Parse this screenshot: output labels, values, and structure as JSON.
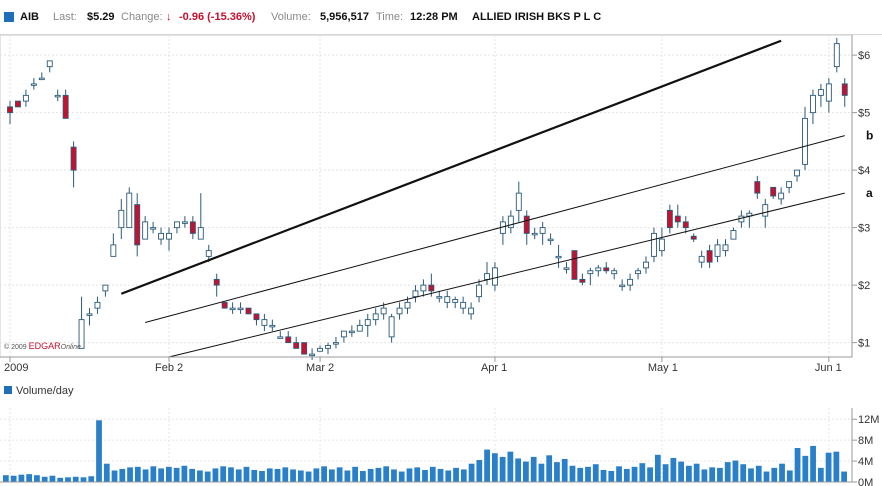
{
  "header": {
    "symbol": "AIB",
    "last_label": "Last:",
    "last_value": "$5.29",
    "change_label": "Change:",
    "change_value": "-0.96 (-15.36%)",
    "volume_label": "Volume:",
    "volume_value": "5,956,517",
    "time_label": "Time:",
    "time_value": "12:28 PM",
    "company": "ALLIED IRISH BKS P L C",
    "accent_color": "#1f6fb8",
    "down_color": "#c8102e",
    "arrow_icon": "down-arrow-icon"
  },
  "chart_data": {
    "type": "candlestick",
    "price_axis": {
      "ticks": [
        1,
        2,
        3,
        4,
        5,
        6
      ],
      "tick_labels": [
        "$1",
        "$2",
        "$3",
        "$4",
        "$5",
        "$6"
      ],
      "ylim": [
        0.75,
        6.35
      ]
    },
    "x_labels": [
      {
        "label": "2009",
        "index": 0
      },
      {
        "label": "Feb 2",
        "index": 20
      },
      {
        "label": "Mar 2",
        "index": 39
      },
      {
        "label": "Apr 1",
        "index": 61
      },
      {
        "label": "May 1",
        "index": 82
      },
      {
        "label": "Jun 1",
        "index": 103
      }
    ],
    "candles": [
      [
        5.1,
        5.2,
        4.8,
        5.0
      ],
      [
        5.2,
        5.2,
        5.1,
        5.1
      ],
      [
        5.2,
        5.4,
        5.1,
        5.3
      ],
      [
        5.5,
        5.6,
        5.4,
        5.5
      ],
      [
        5.6,
        5.7,
        5.6,
        5.6
      ],
      [
        5.8,
        5.9,
        5.7,
        5.9
      ],
      [
        5.3,
        5.4,
        5.2,
        5.3
      ],
      [
        5.3,
        5.4,
        4.9,
        4.9
      ],
      [
        4.4,
        4.5,
        3.7,
        4.0
      ],
      [
        0.9,
        1.8,
        0.9,
        1.4
      ],
      [
        1.5,
        1.6,
        1.3,
        1.5
      ],
      [
        1.6,
        1.8,
        1.5,
        1.7
      ],
      [
        1.9,
        2.0,
        1.8,
        2.0
      ],
      [
        2.5,
        2.9,
        2.5,
        2.7
      ],
      [
        3.0,
        3.5,
        2.8,
        3.3
      ],
      [
        3.0,
        3.7,
        3.0,
        3.6
      ],
      [
        3.4,
        3.6,
        2.5,
        2.7
      ],
      [
        2.8,
        3.2,
        2.8,
        3.1
      ],
      [
        3.0,
        3.1,
        2.9,
        3.0
      ],
      [
        2.8,
        3.0,
        2.7,
        2.9
      ],
      [
        2.8,
        3.0,
        2.6,
        2.9
      ],
      [
        3.0,
        3.1,
        2.9,
        3.1
      ],
      [
        3.1,
        3.2,
        3.0,
        3.1
      ],
      [
        3.1,
        3.2,
        2.8,
        2.9
      ],
      [
        2.8,
        3.6,
        2.8,
        3.0
      ],
      [
        2.5,
        2.7,
        2.4,
        2.6
      ],
      [
        2.1,
        2.2,
        1.8,
        2.0
      ],
      [
        1.7,
        1.7,
        1.6,
        1.6
      ],
      [
        1.6,
        1.7,
        1.5,
        1.6
      ],
      [
        1.6,
        1.7,
        1.5,
        1.6
      ],
      [
        1.6,
        1.6,
        1.5,
        1.5
      ],
      [
        1.5,
        1.5,
        1.3,
        1.4
      ],
      [
        1.3,
        1.5,
        1.2,
        1.4
      ],
      [
        1.3,
        1.4,
        1.2,
        1.3
      ],
      [
        1.1,
        1.2,
        1.1,
        1.1
      ],
      [
        1.1,
        1.2,
        1.0,
        1.0
      ],
      [
        1.0,
        1.1,
        0.9,
        0.9
      ],
      [
        1.0,
        1.0,
        0.8,
        0.8
      ],
      [
        0.8,
        0.9,
        0.7,
        0.8
      ],
      [
        0.85,
        0.95,
        0.85,
        0.9
      ],
      [
        0.9,
        1.0,
        0.8,
        0.95
      ],
      [
        1.0,
        1.1,
        0.9,
        1.0
      ],
      [
        1.1,
        1.2,
        1.0,
        1.2
      ],
      [
        1.2,
        1.3,
        1.1,
        1.2
      ],
      [
        1.2,
        1.4,
        1.2,
        1.3
      ],
      [
        1.3,
        1.5,
        1.1,
        1.4
      ],
      [
        1.4,
        1.6,
        1.3,
        1.5
      ],
      [
        1.5,
        1.7,
        1.4,
        1.6
      ],
      [
        1.1,
        1.5,
        1.0,
        1.45
      ],
      [
        1.5,
        1.7,
        1.4,
        1.6
      ],
      [
        1.6,
        1.8,
        1.5,
        1.7
      ],
      [
        1.8,
        2.0,
        1.7,
        1.9
      ],
      [
        1.9,
        2.1,
        1.8,
        2.0
      ],
      [
        2.0,
        2.2,
        1.8,
        1.9
      ],
      [
        1.8,
        1.9,
        1.7,
        1.8
      ],
      [
        1.7,
        1.9,
        1.6,
        1.8
      ],
      [
        1.7,
        1.8,
        1.6,
        1.75
      ],
      [
        1.6,
        1.8,
        1.5,
        1.7
      ],
      [
        1.5,
        1.7,
        1.4,
        1.6
      ],
      [
        1.8,
        2.1,
        1.7,
        2.0
      ],
      [
        2.1,
        2.4,
        2.0,
        2.2
      ],
      [
        2.0,
        2.4,
        1.9,
        2.3
      ],
      [
        2.9,
        3.2,
        2.7,
        3.1
      ],
      [
        3.0,
        3.3,
        2.9,
        3.2
      ],
      [
        3.3,
        3.8,
        3.1,
        3.6
      ],
      [
        3.2,
        3.3,
        2.7,
        2.9
      ],
      [
        2.9,
        3.0,
        2.8,
        2.9
      ],
      [
        2.9,
        3.1,
        2.7,
        3.0
      ],
      [
        2.8,
        2.9,
        2.7,
        2.8
      ],
      [
        2.5,
        2.7,
        2.3,
        2.5
      ],
      [
        2.3,
        2.4,
        2.2,
        2.3
      ],
      [
        2.6,
        2.6,
        2.1,
        2.1
      ],
      [
        2.1,
        2.2,
        2.0,
        2.05
      ],
      [
        2.2,
        2.3,
        2.0,
        2.25
      ],
      [
        2.25,
        2.35,
        2.15,
        2.3
      ],
      [
        2.3,
        2.4,
        2.2,
        2.25
      ],
      [
        2.2,
        2.3,
        2.1,
        2.25
      ],
      [
        2.0,
        2.1,
        1.9,
        2.0
      ],
      [
        2.0,
        2.2,
        1.9,
        2.1
      ],
      [
        2.2,
        2.3,
        2.1,
        2.25
      ],
      [
        2.3,
        2.5,
        2.2,
        2.4
      ],
      [
        2.5,
        3.0,
        2.4,
        2.9
      ],
      [
        2.6,
        3.0,
        2.5,
        2.8
      ],
      [
        3.3,
        3.4,
        2.9,
        3.0
      ],
      [
        3.2,
        3.4,
        3.0,
        3.1
      ],
      [
        3.1,
        3.2,
        2.9,
        3.0
      ],
      [
        2.85,
        2.9,
        2.75,
        2.8
      ],
      [
        2.4,
        2.6,
        2.3,
        2.5
      ],
      [
        2.6,
        2.7,
        2.3,
        2.4
      ],
      [
        2.5,
        2.8,
        2.4,
        2.7
      ],
      [
        2.6,
        2.8,
        2.5,
        2.7
      ],
      [
        2.8,
        3.0,
        2.8,
        2.95
      ],
      [
        3.1,
        3.3,
        3.0,
        3.2
      ],
      [
        3.2,
        3.3,
        3.0,
        3.25
      ],
      [
        3.8,
        3.9,
        3.5,
        3.6
      ],
      [
        3.2,
        3.5,
        3.0,
        3.4
      ],
      [
        3.7,
        3.7,
        3.5,
        3.55
      ],
      [
        3.5,
        3.7,
        3.4,
        3.6
      ],
      [
        3.7,
        3.8,
        3.6,
        3.8
      ],
      [
        3.9,
        4.0,
        3.8,
        4.0
      ],
      [
        4.1,
        5.1,
        4.0,
        4.9
      ],
      [
        5.0,
        5.4,
        4.8,
        5.3
      ],
      [
        5.3,
        5.5,
        5.1,
        5.4
      ],
      [
        5.2,
        5.6,
        5.0,
        5.5
      ],
      [
        5.8,
        6.3,
        5.7,
        6.2
      ],
      [
        5.5,
        5.6,
        5.1,
        5.3
      ]
    ],
    "trendlines": [
      {
        "name": "upper",
        "from": [
          14,
          1.85
        ],
        "to": [
          97,
          6.25
        ],
        "heavy": true
      },
      {
        "name": "channel-top",
        "from": [
          17,
          1.35
        ],
        "to": [
          105,
          4.6
        ]
      },
      {
        "name": "channel-bottom",
        "from": [
          20,
          0.75
        ],
        "to": [
          105,
          3.6
        ]
      }
    ],
    "line_labels": [
      {
        "label": "b",
        "line": "channel-top",
        "value": 4.6
      },
      {
        "label": "a",
        "line": "channel-bottom",
        "value": 3.6
      }
    ],
    "watermark": {
      "prefix": "© 2009 ",
      "brand": "EDGAR",
      "suffix": "Online"
    },
    "volume": {
      "title": "Volume/day",
      "tick_labels": [
        "12M",
        "8M",
        "4M",
        "0M"
      ],
      "ticks": [
        12,
        8,
        4,
        0
      ],
      "ylim": [
        0,
        13
      ],
      "values": [
        1.3,
        1.2,
        1.4,
        1.5,
        1.3,
        1.0,
        1.2,
        0.8,
        0.9,
        1.0,
        0.9,
        1.1,
        11.8,
        3.5,
        2.2,
        2.5,
        2.8,
        2.9,
        2.4,
        3.0,
        2.6,
        2.9,
        2.7,
        3.1,
        2.5,
        2.2,
        2.0,
        2.6,
        3.0,
        2.8,
        2.4,
        2.9,
        2.3,
        2.1,
        2.6,
        2.5,
        2.8,
        2.4,
        2.2,
        2.0,
        2.6,
        3.0,
        2.4,
        2.8,
        2.2,
        2.9,
        2.1,
        2.5,
        2.7,
        3.0,
        2.4,
        2.0,
        2.6,
        2.8,
        2.3,
        2.9,
        2.5,
        2.2,
        2.7,
        2.4,
        3.5,
        4.2,
        6.2,
        5.5,
        4.8,
        5.8,
        4.5,
        3.9,
        4.8,
        3.5,
        5.1,
        3.8,
        4.4,
        3.1,
        2.7,
        2.9,
        3.4,
        2.3,
        2.1,
        3.0,
        2.5,
        2.9,
        3.6,
        2.8,
        5.2,
        3.4,
        4.6,
        3.9,
        3.1,
        3.5,
        2.4,
        2.8,
        2.7,
        3.8,
        4.1,
        3.4,
        2.6,
        3.1,
        2.0,
        2.7,
        3.5,
        2.2,
        6.5,
        5.0,
        6.9,
        2.7,
        5.6,
        5.8,
        2.0
      ]
    }
  }
}
